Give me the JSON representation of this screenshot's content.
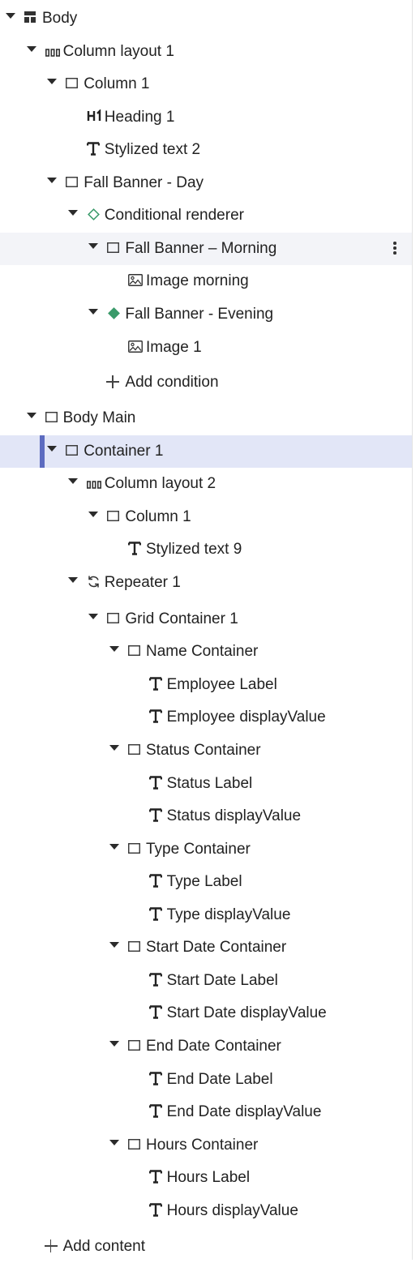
{
  "tree": {
    "nodes": [
      {
        "name": "body",
        "label": "Body",
        "icon": "body-layout-icon"
      },
      {
        "name": "column-layout-1",
        "label": "Column layout 1",
        "icon": "column-layout-icon"
      },
      {
        "name": "column-1",
        "label": "Column 1",
        "icon": "container-icon"
      },
      {
        "name": "heading-1",
        "label": "Heading 1",
        "icon": "heading-icon"
      },
      {
        "name": "stylized-text-2",
        "label": "Stylized text 2",
        "icon": "text-icon"
      },
      {
        "name": "fall-banner-day",
        "label": "Fall Banner - Day",
        "icon": "container-icon"
      },
      {
        "name": "conditional-renderer",
        "label": "Conditional renderer",
        "icon": "conditional-outline-icon"
      },
      {
        "name": "fall-banner-morning",
        "label": "Fall Banner – Morning",
        "icon": "container-icon"
      },
      {
        "name": "image-morning",
        "label": "Image morning",
        "icon": "image-icon"
      },
      {
        "name": "fall-banner-evening",
        "label": "Fall Banner - Evening",
        "icon": "conditional-filled-icon"
      },
      {
        "name": "image-1",
        "label": "Image 1",
        "icon": "image-icon"
      },
      {
        "name": "add-condition",
        "label": "Add condition",
        "icon": "plus-icon"
      },
      {
        "name": "body-main",
        "label": "Body Main",
        "icon": "container-icon"
      },
      {
        "name": "container-1",
        "label": "Container 1",
        "icon": "container-icon"
      },
      {
        "name": "column-layout-2",
        "label": "Column layout 2",
        "icon": "column-layout-icon"
      },
      {
        "name": "column-1-b",
        "label": "Column 1",
        "icon": "container-icon"
      },
      {
        "name": "stylized-text-9",
        "label": "Stylized text 9",
        "icon": "text-icon"
      },
      {
        "name": "repeater-1",
        "label": "Repeater 1",
        "icon": "repeater-icon"
      },
      {
        "name": "grid-container-1",
        "label": "Grid Container 1",
        "icon": "container-icon"
      },
      {
        "name": "name-container",
        "label": "Name Container",
        "icon": "container-icon"
      },
      {
        "name": "employee-label",
        "label": "Employee Label",
        "icon": "text-icon"
      },
      {
        "name": "employee-display-value",
        "label": "Employee displayValue",
        "icon": "text-icon"
      },
      {
        "name": "status-container",
        "label": "Status Container",
        "icon": "container-icon"
      },
      {
        "name": "status-label",
        "label": "Status Label",
        "icon": "text-icon"
      },
      {
        "name": "status-display-value",
        "label": "Status displayValue",
        "icon": "text-icon"
      },
      {
        "name": "type-container",
        "label": "Type Container",
        "icon": "container-icon"
      },
      {
        "name": "type-label",
        "label": "Type Label",
        "icon": "text-icon"
      },
      {
        "name": "type-display-value",
        "label": "Type displayValue",
        "icon": "text-icon"
      },
      {
        "name": "start-date-container",
        "label": "Start Date Container",
        "icon": "container-icon"
      },
      {
        "name": "start-date-label",
        "label": "Start Date Label",
        "icon": "text-icon"
      },
      {
        "name": "start-date-display-value",
        "label": "Start Date displayValue",
        "icon": "text-icon"
      },
      {
        "name": "end-date-container",
        "label": "End Date Container",
        "icon": "container-icon"
      },
      {
        "name": "end-date-label",
        "label": "End Date Label",
        "icon": "text-icon"
      },
      {
        "name": "end-date-display-value",
        "label": "End Date displayValue",
        "icon": "text-icon"
      },
      {
        "name": "hours-container",
        "label": "Hours Container",
        "icon": "container-icon"
      },
      {
        "name": "hours-label",
        "label": "Hours Label",
        "icon": "text-icon"
      },
      {
        "name": "hours-display-value",
        "label": "Hours displayValue",
        "icon": "text-icon"
      },
      {
        "name": "add-content",
        "label": "Add content",
        "icon": "plus-icon"
      }
    ]
  },
  "states": {
    "hovered_node": "fall-banner-morning",
    "selected_node": "container-1",
    "expanded_nodes": [
      "body",
      "column-layout-1",
      "column-1",
      "fall-banner-day",
      "conditional-renderer",
      "fall-banner-morning",
      "fall-banner-evening",
      "body-main",
      "container-1",
      "column-layout-2",
      "column-1-b",
      "repeater-1",
      "grid-container-1",
      "name-container",
      "status-container",
      "type-container",
      "start-date-container",
      "end-date-container",
      "hours-container"
    ]
  },
  "colors": {
    "selected_row": "#e2e6f7",
    "selected_accent": "#5c6bc0",
    "hover_row": "#f3f4f8",
    "conditional_icon": "#3a9a6a",
    "text": "#222222"
  }
}
